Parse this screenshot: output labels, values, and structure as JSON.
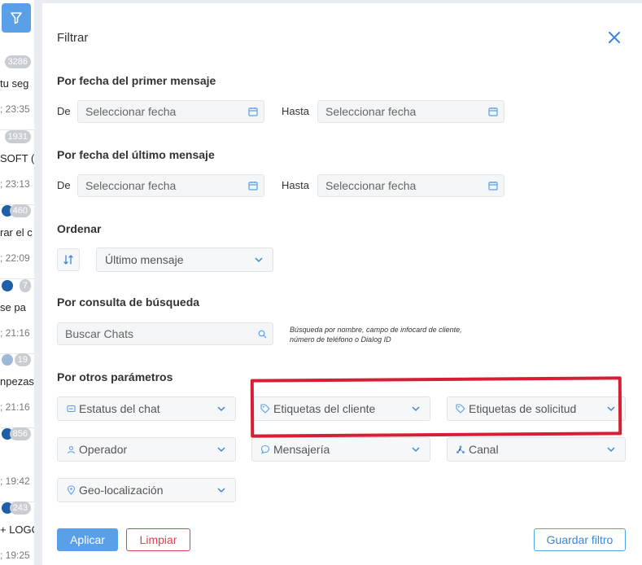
{
  "left_list": {
    "items": [
      {
        "badge": "3286",
        "name": "tu seg",
        "time": "; 23:35",
        "icon": "none"
      },
      {
        "badge": "1931",
        "name": "SOFT (",
        "time": "; 23:13",
        "icon": "none"
      },
      {
        "badge": "460",
        "name": "rar el c",
        "time": "; 22:09",
        "icon": "dark"
      },
      {
        "badge": "7",
        "name": "se pa",
        "time": "; 21:16",
        "icon": "dark"
      },
      {
        "badge": "19",
        "name": "npezas",
        "time": "; 21:16",
        "icon": "light"
      },
      {
        "badge": "856",
        "name": "",
        "time": "; 19:42",
        "icon": "dark"
      },
      {
        "badge": "243",
        "name": "+ LOGO",
        "time": "; 19:25",
        "icon": "dark"
      }
    ]
  },
  "modal": {
    "title": "Filtrar",
    "first_message": {
      "heading": "Por fecha del primer mensaje",
      "from_label": "De",
      "from_placeholder": "Seleccionar fecha",
      "to_label": "Hasta",
      "to_placeholder": "Seleccionar fecha"
    },
    "last_message": {
      "heading": "Por fecha del último mensaje",
      "from_label": "De",
      "from_placeholder": "Seleccionar fecha",
      "to_label": "Hasta",
      "to_placeholder": "Seleccionar fecha"
    },
    "order": {
      "heading": "Ordenar",
      "selected": "Último mensaje"
    },
    "search": {
      "heading": "Por consulta de búsqueda",
      "placeholder": "Buscar Chats",
      "hint": "Búsqueda por nombre, campo de infocard de cliente, número de teléfono o Dialog ID"
    },
    "other": {
      "heading": "Por otros parámetros",
      "filters": [
        {
          "label": "Estatus del chat",
          "icon": "chat-status-icon"
        },
        {
          "label": "Etiquetas del cliente",
          "icon": "tag-icon"
        },
        {
          "label": "Etiquetas de solicitud",
          "icon": "tag-icon"
        },
        {
          "label": "Operador",
          "icon": "person-icon"
        },
        {
          "label": "Mensajería",
          "icon": "message-bubble-icon"
        },
        {
          "label": "Canal",
          "icon": "channel-icon"
        },
        {
          "label": "Geo-localización",
          "icon": "location-pin-icon"
        }
      ]
    },
    "buttons": {
      "apply": "Aplicar",
      "clear": "Limpiar",
      "save": "Guardar filtro"
    }
  },
  "colors": {
    "accent": "#5aa0e8",
    "danger": "#d9434f",
    "highlight": "#d61f35"
  }
}
